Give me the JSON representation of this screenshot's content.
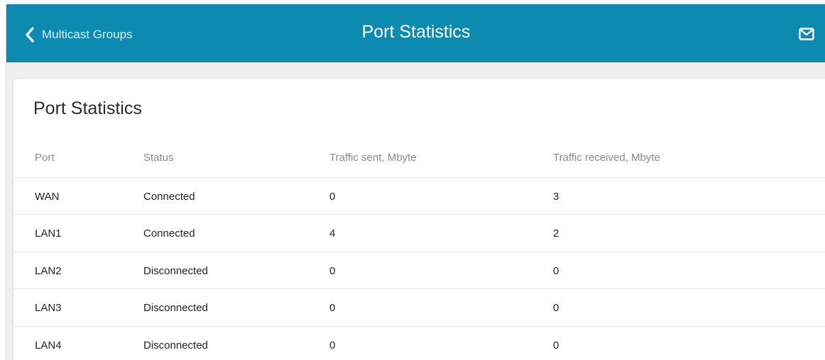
{
  "header": {
    "back_label": "Multicast Groups",
    "title": "Port Statistics",
    "background": "#0c8ab0"
  },
  "card": {
    "title": "Port Statistics"
  },
  "table": {
    "columns": [
      "Port",
      "Status",
      "Traffic sent, Mbyte",
      "Traffic received, Mbyte"
    ],
    "rows": [
      {
        "port": "WAN",
        "status": "Connected",
        "sent": "0",
        "received": "3"
      },
      {
        "port": "LAN1",
        "status": "Connected",
        "sent": "4",
        "received": "2"
      },
      {
        "port": "LAN2",
        "status": "Disconnected",
        "sent": "0",
        "received": "0"
      },
      {
        "port": "LAN3",
        "status": "Disconnected",
        "sent": "0",
        "received": "0"
      },
      {
        "port": "LAN4",
        "status": "Disconnected",
        "sent": "0",
        "received": "0"
      }
    ]
  },
  "colors": {
    "connected": "#2e9e2e",
    "disconnected": "#e2451c"
  },
  "icons": {
    "back": "chevron-left-icon",
    "notifications": "mail-icon"
  }
}
